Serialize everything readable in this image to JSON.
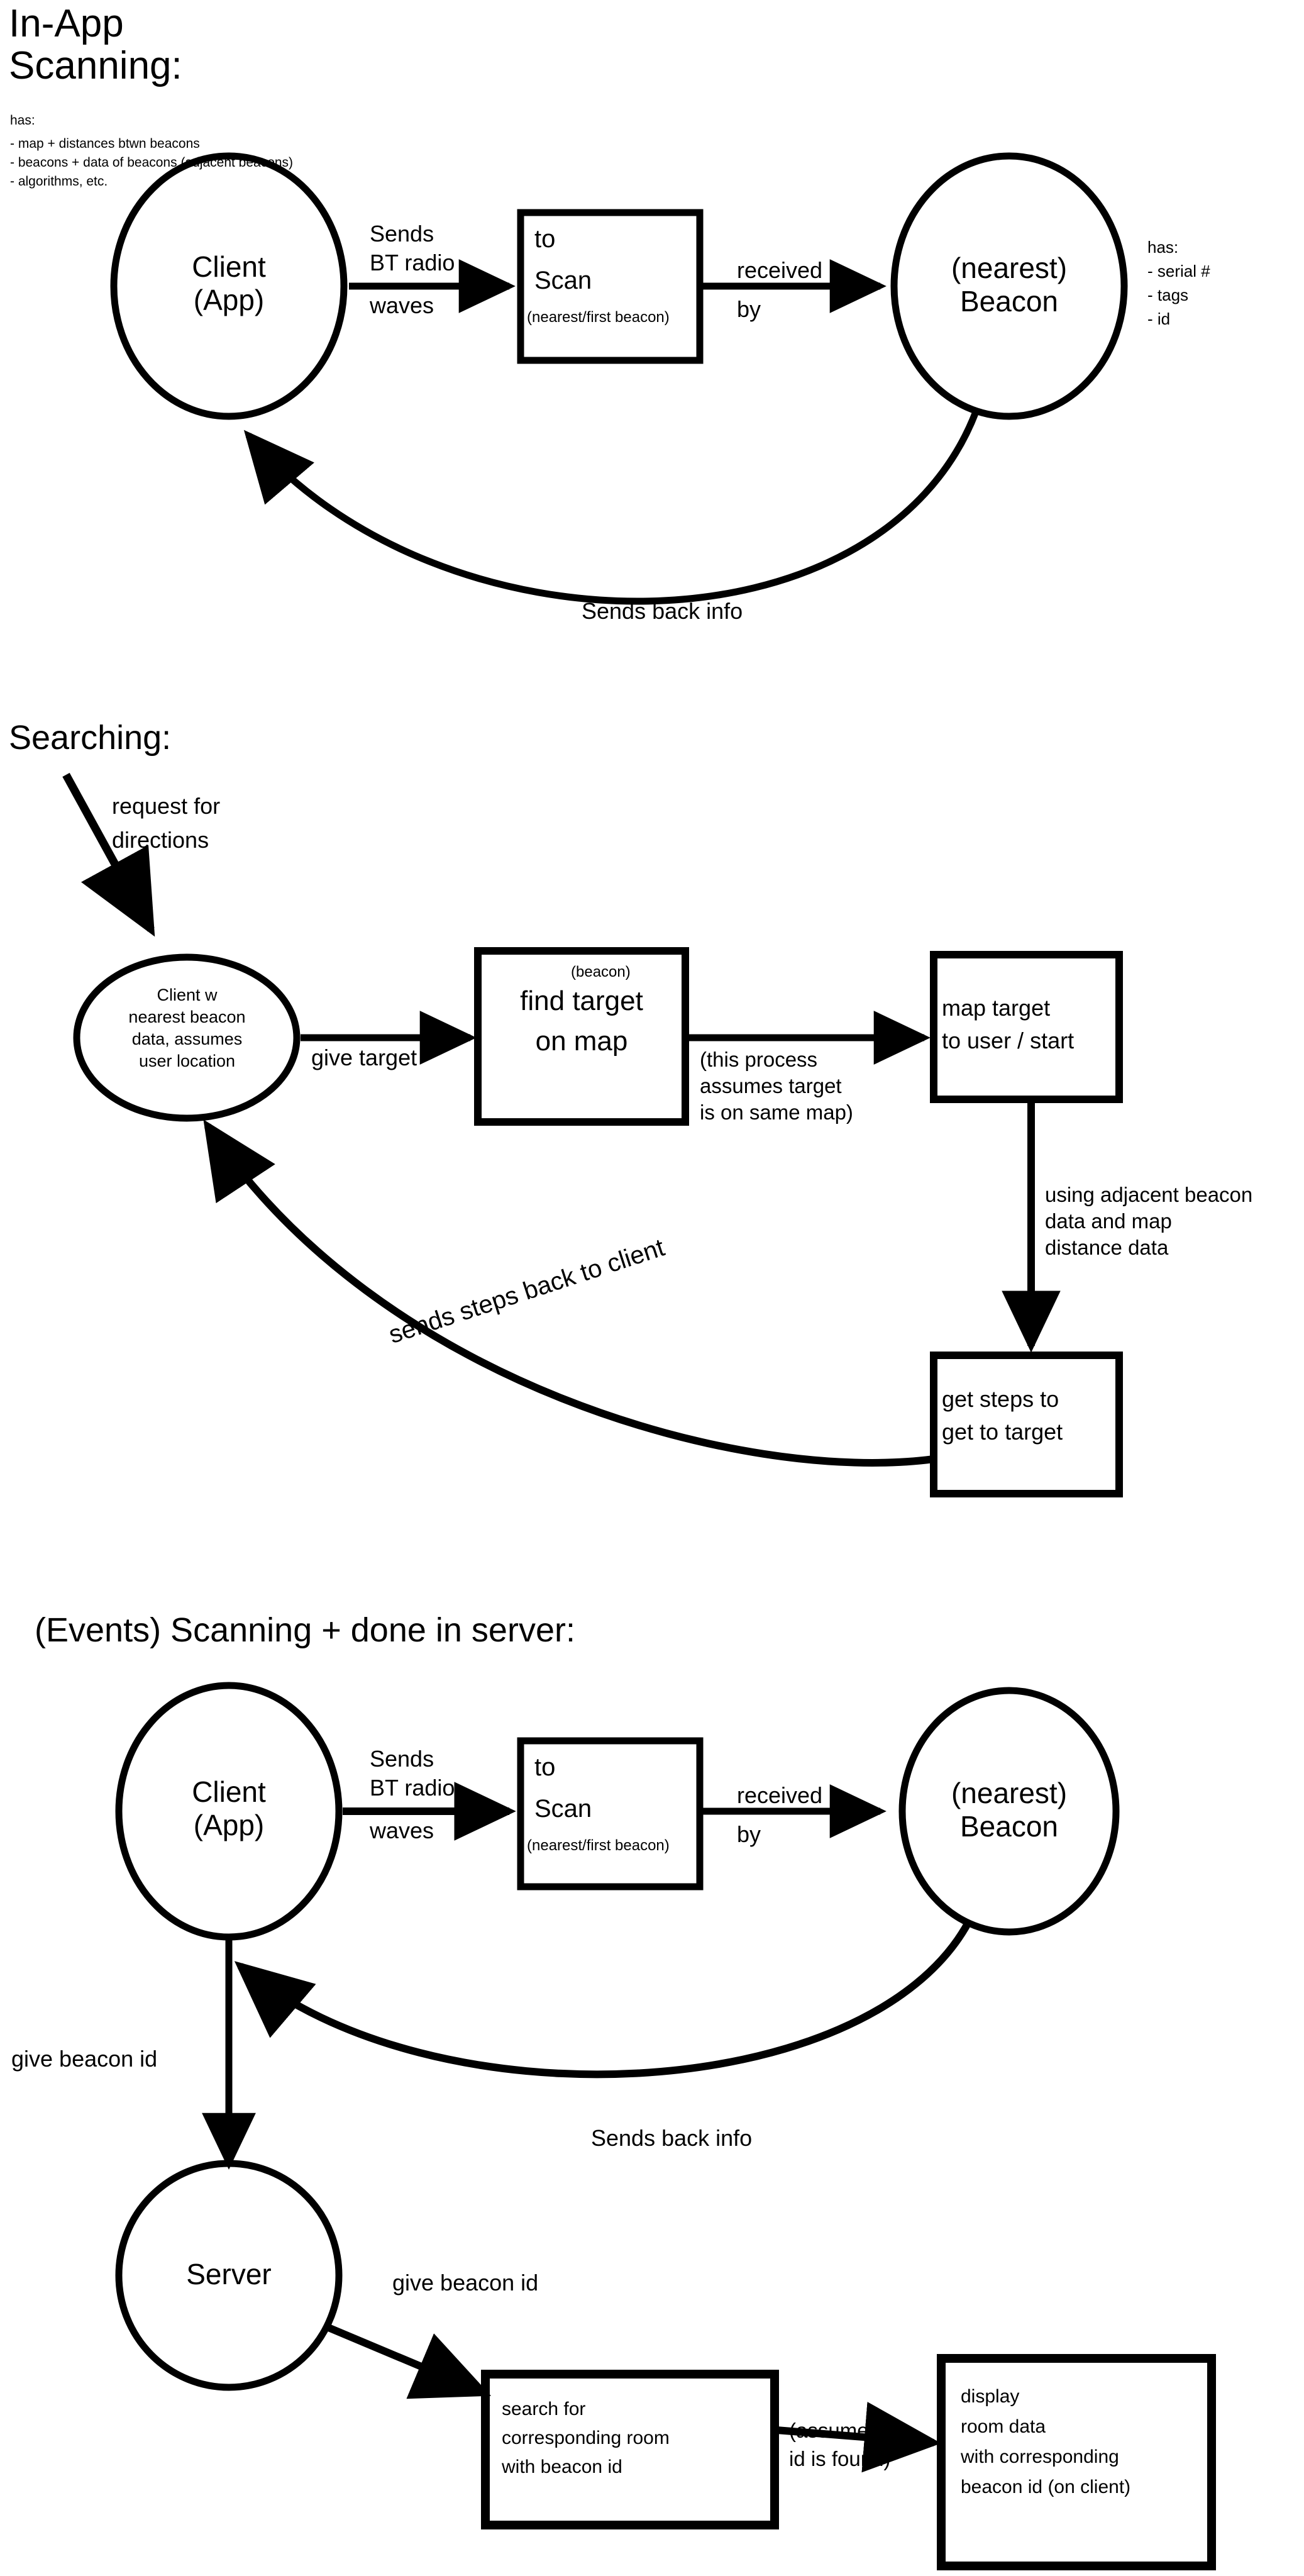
{
  "sections": {
    "scanning": {
      "title_line1": "In-App",
      "title_line2": "Scanning:",
      "client_has": {
        "heading": "has:",
        "items": [
          "- map + distances btwn beacons",
          "- beacons + data of beacons (adjacent beacons)",
          "- algorithms, etc."
        ]
      },
      "client_node": {
        "line1": "Client",
        "line2": "(App)"
      },
      "edge_sends": {
        "line1": "Sends",
        "line2": "BT radio",
        "line3": "waves"
      },
      "scan_box": {
        "line1": "to",
        "line2": "Scan",
        "sub": "(nearest/first beacon)"
      },
      "edge_received": {
        "line1": "received",
        "line2": "by"
      },
      "beacon_node": {
        "line1": "(nearest)",
        "line2": "Beacon"
      },
      "beacon_has": {
        "heading": "has:",
        "items": [
          "- serial #",
          "- tags",
          "- id"
        ]
      },
      "edge_return": "Sends back info"
    },
    "searching": {
      "title": "Searching:",
      "edge_request": {
        "line1": "request for",
        "line2": "directions"
      },
      "client_node": {
        "line1": "Client w",
        "line2": "nearest beacon",
        "line3": "data, assumes",
        "line4": "user location"
      },
      "edge_give_target": "give target",
      "find_box": {
        "sup": "(beacon)",
        "line1": "find target",
        "line2": "on map"
      },
      "note_same_map": {
        "line1": "(this process",
        "line2": "assumes target",
        "line3": "is on same map)"
      },
      "map_box": {
        "line1": "map target",
        "line2": "to user / start"
      },
      "note_adjacent": {
        "line1": "using adjacent beacon",
        "line2": "data and map",
        "line3": "distance data"
      },
      "steps_box": {
        "line1": "get steps to",
        "line2": "get to target"
      },
      "edge_send_steps": "sends steps back to client"
    },
    "events": {
      "title": "(Events) Scanning + done in server:",
      "client_node": {
        "line1": "Client",
        "line2": "(App)"
      },
      "edge_sends": {
        "line1": "Sends",
        "line2": "BT radio",
        "line3": "waves"
      },
      "scan_box": {
        "line1": "to",
        "line2": "Scan",
        "sub": "(nearest/first beacon)"
      },
      "edge_received": {
        "line1": "received",
        "line2": "by"
      },
      "beacon_node": {
        "line1": "(nearest)",
        "line2": "Beacon"
      },
      "edge_return": "Sends back info",
      "edge_give_beacon_id_1": "give beacon id",
      "server_node": "Server",
      "edge_give_beacon_id_2": "give beacon id",
      "search_box": {
        "line1": "search for",
        "line2": "corresponding room",
        "line3": "with beacon id"
      },
      "note_id_found": {
        "line1": "(assumes",
        "line2": "id is found)"
      },
      "display_box": {
        "line1": "display",
        "line2": "room data",
        "line3": "with corresponding",
        "line4": "beacon id (on client)"
      }
    }
  },
  "style": {
    "ink": "#000000",
    "paper": "#ffffff"
  }
}
